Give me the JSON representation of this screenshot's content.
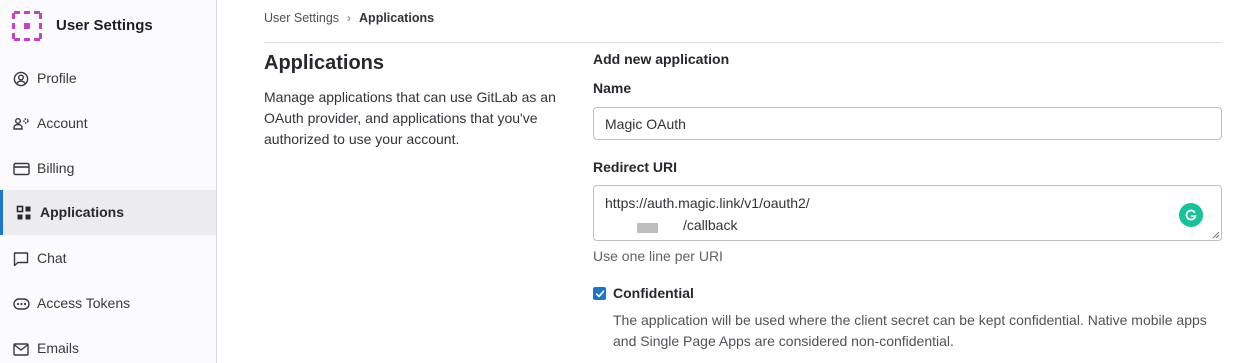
{
  "sidebar": {
    "title": "User Settings",
    "items": [
      {
        "label": "Profile",
        "icon": "profile-icon"
      },
      {
        "label": "Account",
        "icon": "account-icon"
      },
      {
        "label": "Billing",
        "icon": "billing-icon"
      },
      {
        "label": "Applications",
        "icon": "applications-icon",
        "active": true
      },
      {
        "label": "Chat",
        "icon": "chat-icon"
      },
      {
        "label": "Access Tokens",
        "icon": "token-icon"
      },
      {
        "label": "Emails",
        "icon": "email-icon"
      }
    ]
  },
  "breadcrumb": {
    "parent": "User Settings",
    "separator": "›",
    "current": "Applications"
  },
  "page": {
    "title": "Applications",
    "description": "Manage applications that can use GitLab as an OAuth provider, and applications that you've authorized to use your account."
  },
  "form": {
    "heading": "Add new application",
    "name_label": "Name",
    "name_value": "Magic OAuth",
    "redirect_label": "Redirect URI",
    "redirect_line1": "https://auth.magic.link/v1/oauth2/",
    "redirect_line2": "/callback",
    "redirect_help": "Use one line per URI",
    "confidential_label": "Confidential",
    "confidential_checked": true,
    "confidential_help": "The application will be used where the client secret can be kept confidential. Native mobile apps and Single Page Apps are considered non-confidential."
  },
  "colors": {
    "accent": "#1f75cb",
    "logo": "#c740c7",
    "grammarly": "#15c39a"
  }
}
